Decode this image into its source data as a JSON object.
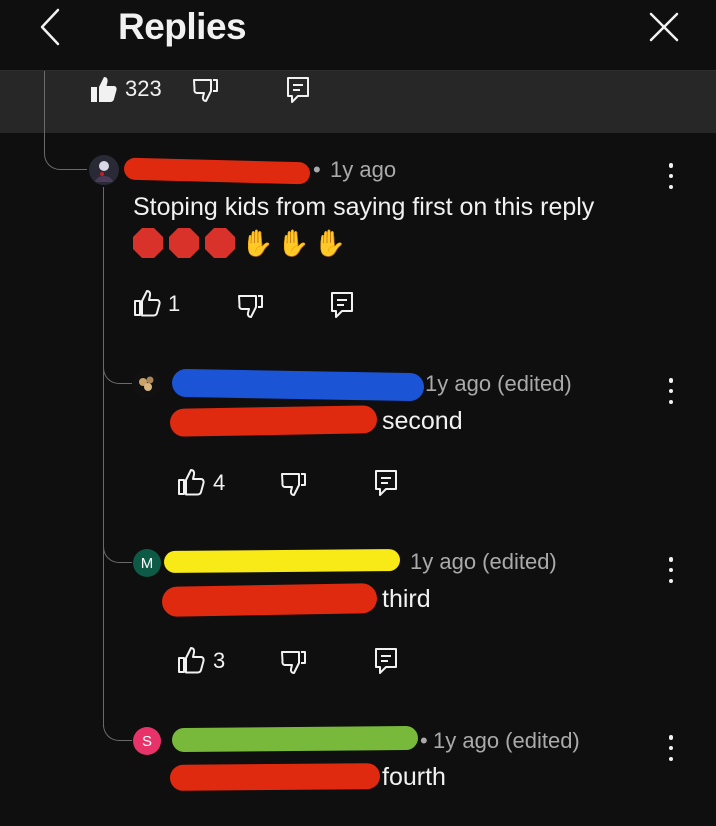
{
  "header": {
    "title": "Replies"
  },
  "parent": {
    "like_count": "323"
  },
  "comments": [
    {
      "time": "1y ago",
      "text": "Stoping kids from saying first on this reply",
      "emojis": "✋✋✋",
      "like_count": "1",
      "avatar_letter": ""
    },
    {
      "time": "1y ago (edited)",
      "text": "second",
      "like_count": "4",
      "avatar_letter": ""
    },
    {
      "time": "1y ago (edited)",
      "text": "third",
      "like_count": "3",
      "avatar_letter": "M"
    },
    {
      "time": "1y ago (edited)",
      "text": "fourth",
      "avatar_letter": "S"
    }
  ],
  "colors": {
    "background": "#0f0f0f",
    "parent_bg": "#272727",
    "scribble_red": "#e02a10",
    "scribble_blue": "#1b55d6",
    "scribble_yellow": "#f7ea16",
    "scribble_green": "#78b93c",
    "avatar_m": "#0d5a46",
    "avatar_s": "#e8336a"
  }
}
